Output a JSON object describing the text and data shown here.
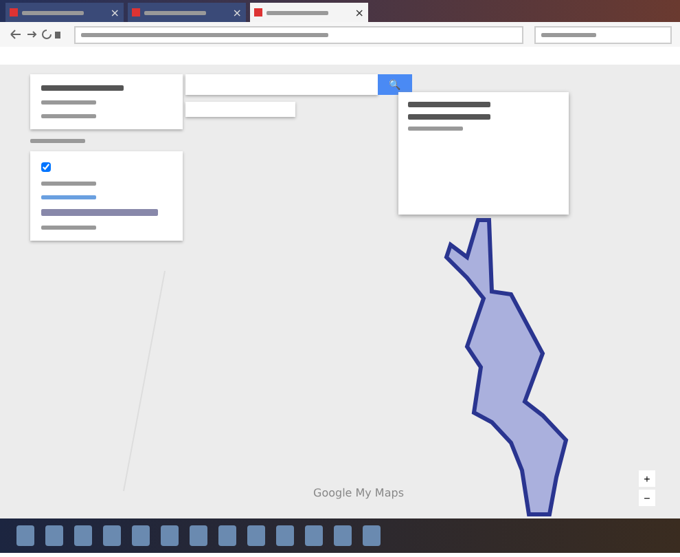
{
  "browser": {
    "tabs": [
      {
        "close": "×",
        "selected": false
      },
      {
        "close": "×",
        "selected": false
      },
      {
        "close": "×",
        "selected": true
      }
    ]
  },
  "sidebar": {
    "layer": {
      "checked": true
    }
  },
  "map": {
    "search_button": "🔍",
    "footer": "Google My Maps",
    "zoom_in": "+",
    "zoom_out": "−"
  }
}
